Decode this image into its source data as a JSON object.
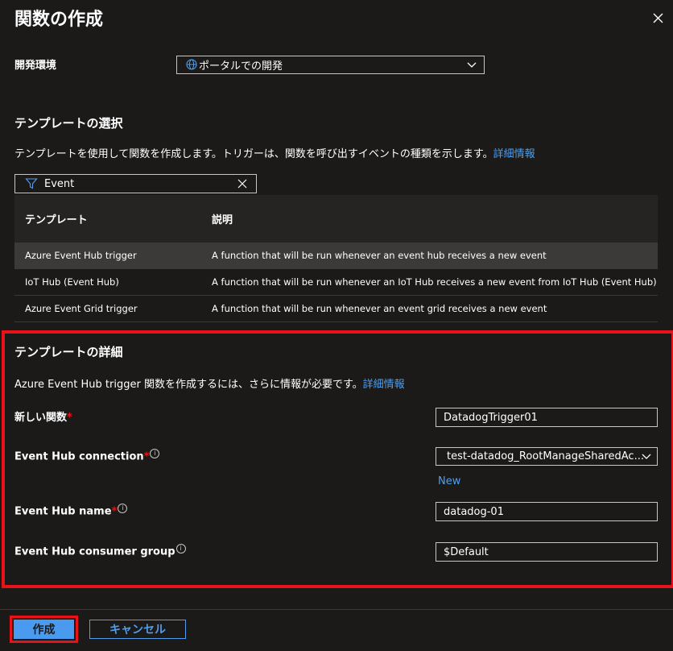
{
  "panel": {
    "title": "関数の作成",
    "close_icon": "close-icon"
  },
  "environment": {
    "label": "開発環境",
    "value": "ポータルでの開発",
    "icon": "globe-icon"
  },
  "template_select": {
    "heading": "テンプレートの選択",
    "description": "テンプレートを使用して関数を作成します。トリガーは、関数を呼び出すイベントの種類を示します。",
    "link": "詳細情報",
    "filter_value": "Event"
  },
  "table": {
    "headers": [
      "テンプレート",
      "説明"
    ],
    "rows": [
      {
        "name": "Azure Event Hub trigger",
        "desc": "A function that will be run whenever an event hub receives a new event"
      },
      {
        "name": "IoT Hub (Event Hub)",
        "desc": "A function that will be run whenever an IoT Hub receives a new event from IoT Hub (Event Hub)"
      },
      {
        "name": "Azure Event Grid trigger",
        "desc": "A function that will be run whenever an event grid receives a new event"
      }
    ]
  },
  "details": {
    "heading": "テンプレートの詳細",
    "description": "Azure Event Hub trigger 関数を作成するには、さらに情報が必要です。",
    "link": "詳細情報",
    "fields": {
      "new_function": {
        "label": "新しい関数",
        "value": "DatadogTrigger01"
      },
      "connection": {
        "label": "Event Hub connection",
        "value": "test-datadog_RootManageSharedAc...",
        "new_link": "New"
      },
      "hub_name": {
        "label": "Event Hub name",
        "value": "datadog-01"
      },
      "consumer_group": {
        "label": "Event Hub consumer group",
        "value": "$Default"
      }
    },
    "required_mark": "*",
    "info_mark": "i"
  },
  "footer": {
    "create_label": "作成",
    "cancel_label": "キャンセル"
  },
  "colors": {
    "background": "#1b1a19",
    "accent": "#4f9eed",
    "highlight": "#e8121a"
  }
}
